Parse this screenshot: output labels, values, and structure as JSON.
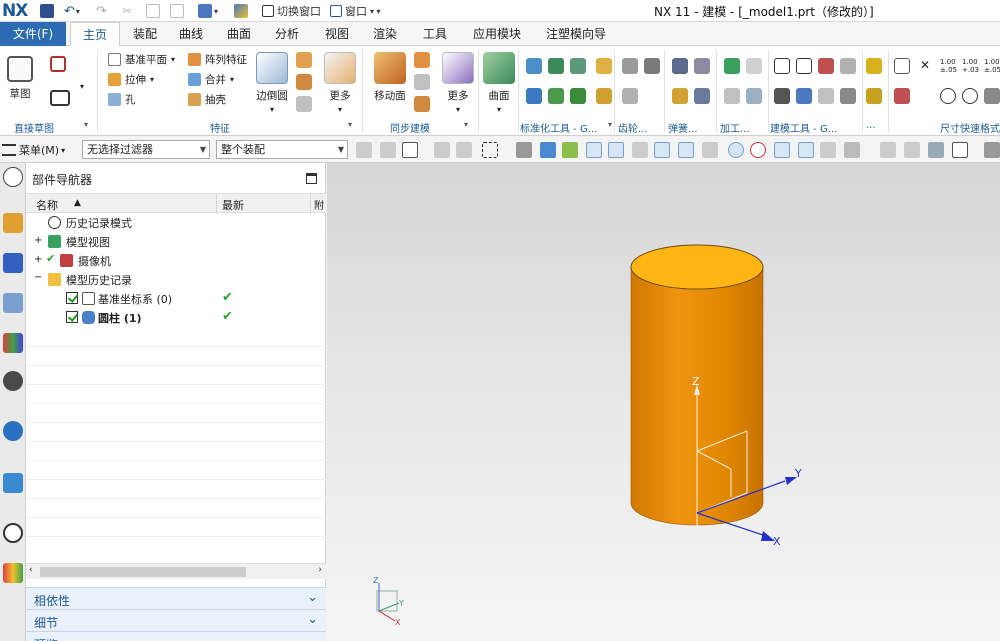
{
  "titlebar": {
    "logo": "NX",
    "switch_window": "切换窗口",
    "window_menu": "窗口",
    "title": "NX 11 - 建模 - [_model1.prt（修改的）]"
  },
  "tabs": [
    {
      "label": "文件(F)"
    },
    {
      "label": "主页"
    },
    {
      "label": "装配"
    },
    {
      "label": "曲线"
    },
    {
      "label": "曲面"
    },
    {
      "label": "分析"
    },
    {
      "label": "视图"
    },
    {
      "label": "渲染"
    },
    {
      "label": "工具"
    },
    {
      "label": "应用模块"
    },
    {
      "label": "注塑模向导"
    }
  ],
  "ribbon": {
    "sketch": "草图",
    "datum_plane": "基准平面",
    "extrude": "拉伸",
    "hole": "孔",
    "pattern_feature": "阵列特征",
    "unite": "合并",
    "shell": "抽壳",
    "edge_blend": "边倒圆",
    "more1": "更多",
    "move_face": "移动面",
    "more2": "更多",
    "surface": "曲面",
    "groups": {
      "direct_sketch": "直接草图",
      "feature": "特征",
      "sync_modeling": "同步建模",
      "std_tools": "标准化工具 - G...",
      "gear": "齿轮...",
      "spring": "弹簧...",
      "machining": "加工...",
      "modeling_tools": "建模工具 - G...",
      "misc": "...",
      "dim_quick_format": "尺寸快速格式"
    },
    "dim_labels": [
      "1.00 ±.05",
      "1.00 +.03",
      "1.00 ±.05"
    ]
  },
  "selbar": {
    "menu": "菜单(M)",
    "filter": "无选择过滤器",
    "scope": "整个装配"
  },
  "navigator": {
    "title": "部件导航器",
    "col_name": "名称",
    "col_latest": "最新",
    "col_extra": "附",
    "rows": [
      {
        "label": "历史记录模式",
        "latest": ""
      },
      {
        "label": "模型视图",
        "latest": ""
      },
      {
        "label": "摄像机",
        "latest": ""
      },
      {
        "label": "模型历史记录",
        "latest": ""
      },
      {
        "label": "基准坐标系 (0)",
        "latest": "✔"
      },
      {
        "label": "圆柱 (1)",
        "latest": "✔"
      }
    ],
    "panels": [
      "相依性",
      "细节",
      "预览"
    ]
  },
  "viewport": {
    "axis_z": "Z",
    "axis_y": "Y",
    "axis_x": "X",
    "triad_z": "Z",
    "triad_y": "Y",
    "triad_x": "X",
    "colors": {
      "cylinder_body": "#e38a00",
      "cylinder_top": "#ffb514",
      "axis_blue": "#2233cc"
    }
  }
}
